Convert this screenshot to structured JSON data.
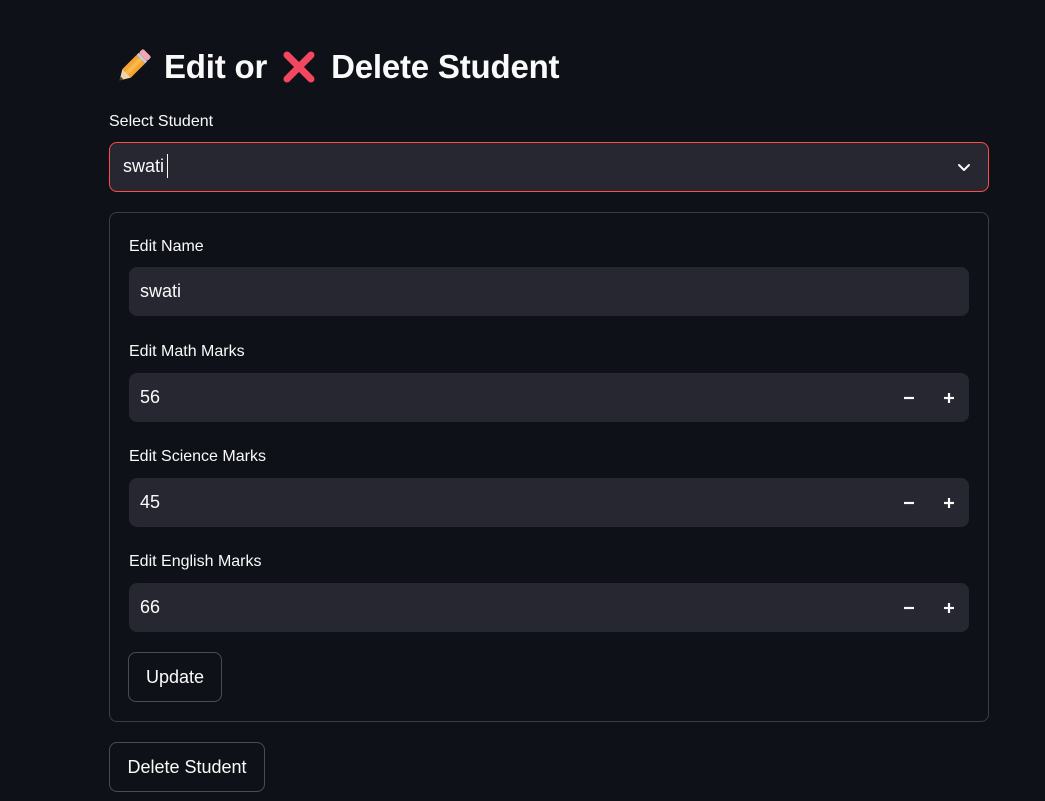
{
  "header": {
    "title_part1": "Edit or",
    "title_part2": "Delete Student",
    "emoji1": "pencil-icon",
    "emoji2": "cross-mark-icon"
  },
  "select_student": {
    "label": "Select Student",
    "value": "swati"
  },
  "form": {
    "name": {
      "label": "Edit Name",
      "value": "swati"
    },
    "math": {
      "label": "Edit Math Marks",
      "value": "56"
    },
    "science": {
      "label": "Edit Science Marks",
      "value": "45"
    },
    "english": {
      "label": "Edit English Marks",
      "value": "66"
    },
    "update_label": "Update"
  },
  "delete_label": "Delete Student",
  "colors": {
    "background": "#0e1117",
    "input_bg": "#262730",
    "accent": "#ff4b4b",
    "text": "#fafafa"
  }
}
